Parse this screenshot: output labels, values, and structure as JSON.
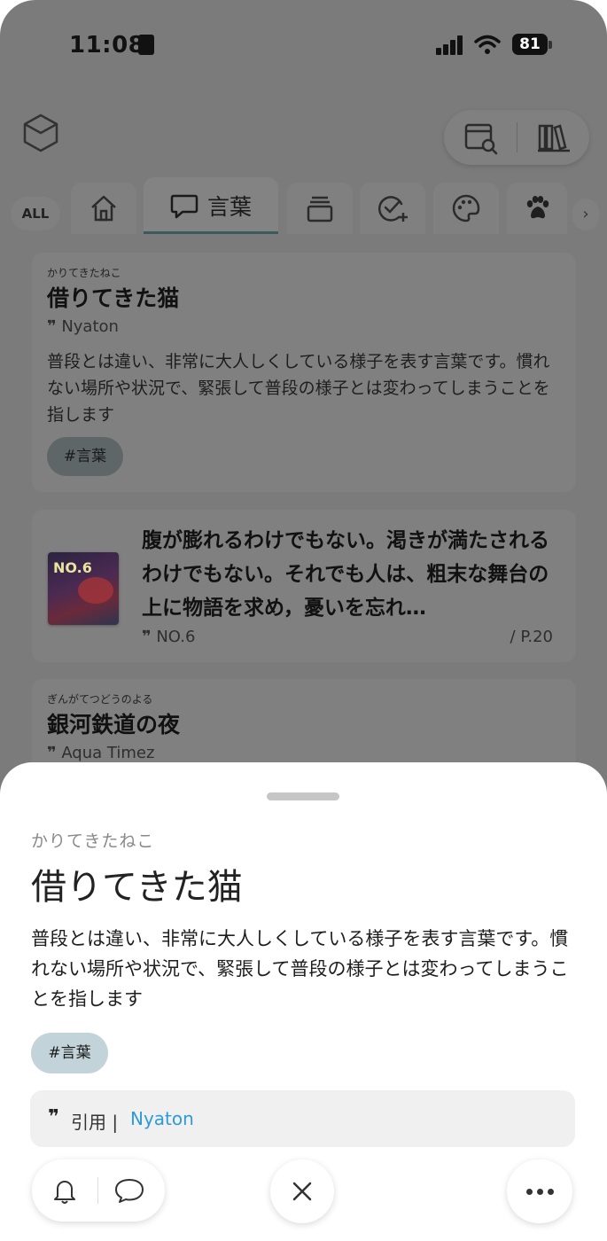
{
  "status_bar": {
    "time": "11:08",
    "battery": "81"
  },
  "tabs": {
    "all_label": "ALL",
    "active_label": "言葉"
  },
  "cards": [
    {
      "ruby": "かりてきたねこ",
      "title": "借りてきた猫",
      "author": "Nyaton",
      "body": "普段とは違い、非常に大人しくしている様子を表す言葉です。慣れない場所や状況で、緊張して普段の様子とは変わってしまうことを指します",
      "tag": "#言葉"
    },
    {
      "cover_text": "NO.6",
      "quote": "腹が膨れるわけでもない。渇きが満たされるわけでもない。それでも人は、粗末な舞台の上に物語を求め，憂いを忘れ…",
      "author": "NO.6",
      "page": "/ P.20"
    },
    {
      "ruby": "ぎんがてつどうのよる",
      "title": "銀河鉄道の夜",
      "author": "Aqua Timez"
    }
  ],
  "sheet": {
    "ruby": "かりてきたねこ",
    "title": "借りてきた猫",
    "body": "普段とは違い、非常に大人しくしている様子を表す言葉です。慣れない場所や状況で、緊張して普段の様子とは変わってしまうことを指します",
    "tag": "#言葉",
    "cite_label": "引用 |",
    "cite_name": "Nyaton"
  }
}
